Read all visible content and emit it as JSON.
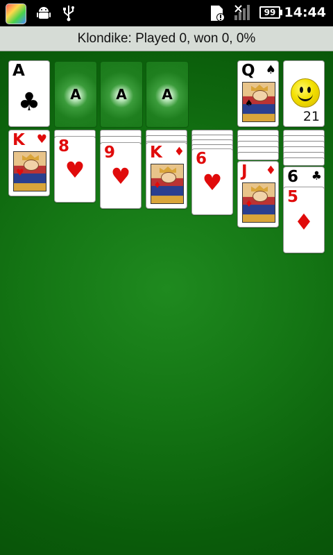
{
  "status_bar": {
    "time": "14:44",
    "battery": "99",
    "icons": [
      "app-icon",
      "android-icon",
      "usb-icon",
      "sd-card-alert-icon",
      "signal-icon",
      "battery-icon"
    ]
  },
  "title": "Klondike:  Played 0, won 0, 0%",
  "stock": {
    "count": "21",
    "icon": "smiley-face-icon"
  },
  "waste": {
    "rank": "Q",
    "suit": "♠"
  },
  "foundations": [
    {
      "rank": "A",
      "suit": "♣"
    },
    {
      "label": "A"
    },
    {
      "label": "A"
    },
    {
      "label": "A"
    }
  ],
  "tableau": [
    {
      "hidden": 0,
      "cards": [
        {
          "rank": "K",
          "suit": "♥"
        }
      ]
    },
    {
      "hidden": 1,
      "cards": [
        {
          "rank": "8",
          "suit": "♥"
        }
      ]
    },
    {
      "hidden": 2,
      "cards": [
        {
          "rank": "9",
          "suit": "♥"
        }
      ]
    },
    {
      "hidden": 3,
      "cards": [
        {
          "rank": "K",
          "suit": "♦"
        }
      ]
    },
    {
      "hidden": 4,
      "cards": [
        {
          "rank": "6",
          "suit": "♥"
        }
      ]
    },
    {
      "hidden": 5,
      "cards": [
        {
          "rank": "J",
          "suit": "♦"
        }
      ]
    },
    {
      "hidden": 6,
      "cards": [
        {
          "rank": "6",
          "suit": "♣"
        },
        {
          "rank": "5",
          "suit": "♦"
        }
      ]
    }
  ],
  "colors": {
    "felt": "#147514",
    "red_suit": "#e00b0b",
    "black_suit": "#000000",
    "title_bg": "#d6dcd6"
  }
}
